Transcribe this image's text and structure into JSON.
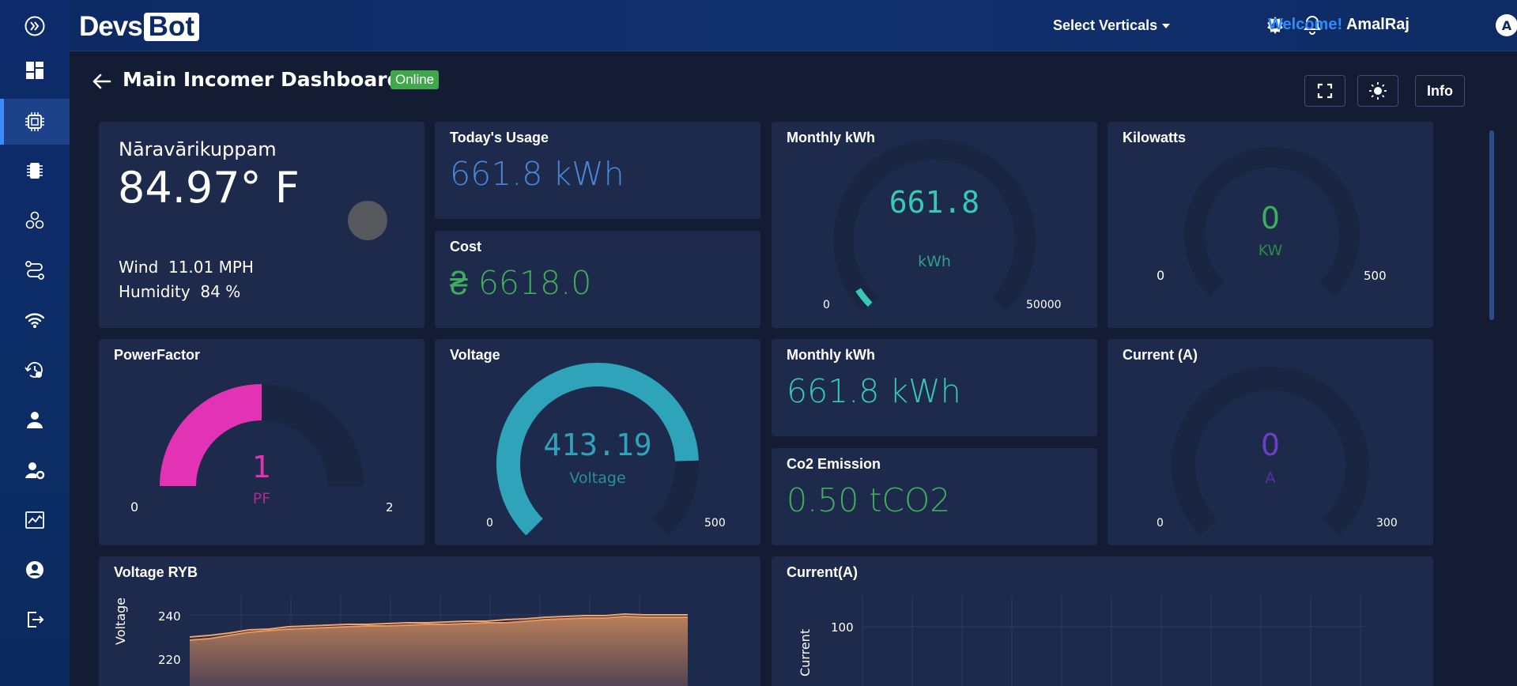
{
  "header": {
    "logo_part1": "Devs",
    "logo_part2": "Bot",
    "verticals_label": "Select Verticals",
    "welcome_label": "Welcome!",
    "user_name": "AmalRaj",
    "avatar_initial": "A"
  },
  "page": {
    "title": "Main Incomer Dashboard",
    "status": "Online",
    "info_label": "Info"
  },
  "weather": {
    "location": "Nāravārikuppam",
    "temperature": "84.97° F",
    "wind_label": "Wind",
    "wind_value": "11.01 MPH",
    "humidity_label": "Humidity",
    "humidity_value": "84 %"
  },
  "todays_usage": {
    "title": "Today's Usage",
    "value": "661.8 kWh"
  },
  "cost": {
    "title": "Cost",
    "value": "₴ 6618.0"
  },
  "monthly_gauge": {
    "title": "Monthly kWh",
    "value": "661.8",
    "unit": "kWh",
    "min": "0",
    "max": "50000",
    "level": 0.013
  },
  "kilowatts_gauge": {
    "title": "Kilowatts",
    "value": "0",
    "unit": "KW",
    "min": "0",
    "max": "500",
    "level": 0
  },
  "powerfactor_gauge": {
    "title": "PowerFactor",
    "value": "1",
    "unit": "PF",
    "min": "0",
    "max": "2",
    "level": 0.5
  },
  "voltage_gauge": {
    "title": "Voltage",
    "value": "413.19",
    "unit": "Voltage",
    "min": "0",
    "max": "500",
    "level": 0.826
  },
  "monthly_kwh": {
    "title": "Monthly kWh",
    "value": "661.8 kWh"
  },
  "co2": {
    "title": "Co2 Emission",
    "value": "0.50 tCO2"
  },
  "current_gauge": {
    "title": "Current (A)",
    "value": "0",
    "unit": "A",
    "min": "0",
    "max": "300",
    "level": 0
  },
  "voltage_ryb": {
    "title": "Voltage RYB",
    "ylabel": "Voltage",
    "yticks": [
      "240",
      "220"
    ]
  },
  "current_chart": {
    "title": "Current(A)",
    "ylabel": "Current",
    "yticks": [
      "100"
    ]
  },
  "colors": {
    "teal": "#36c9b4",
    "green": "#3fae5a",
    "blue": "#4a86d6",
    "magenta": "#e233b5",
    "cyan": "#2ea3b9",
    "purple": "#6b3fc6",
    "orange": "#e89a5c"
  }
}
